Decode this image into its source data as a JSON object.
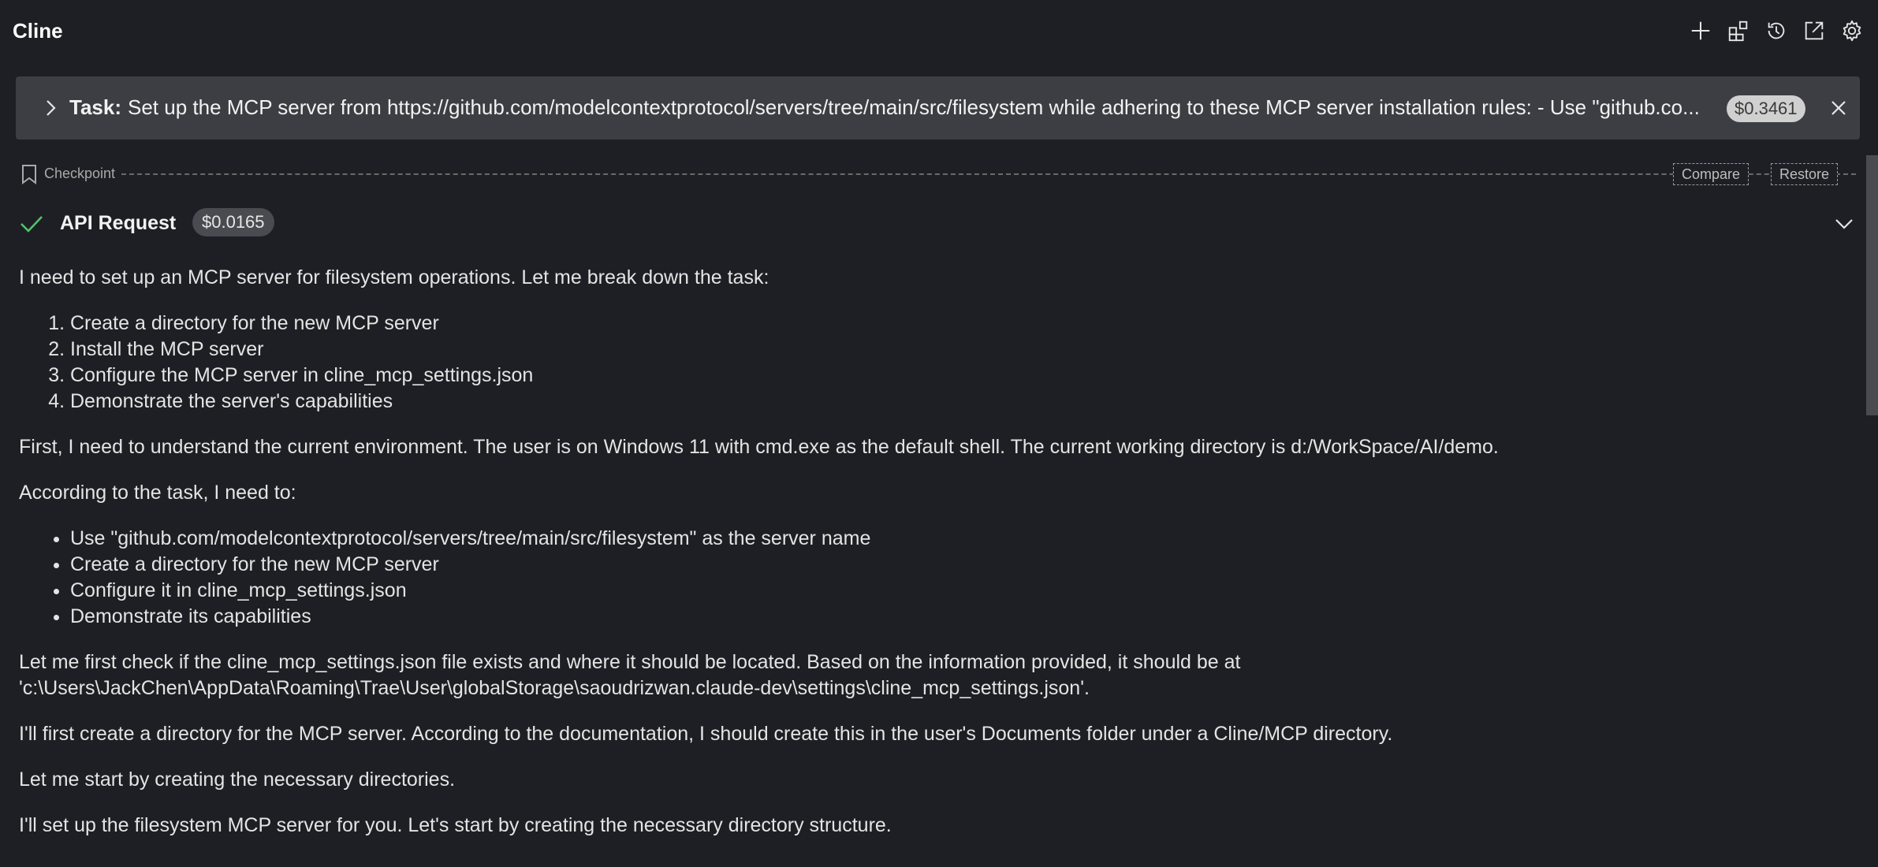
{
  "app": {
    "title": "Cline"
  },
  "header": {
    "actions": [
      {
        "name": "new-task",
        "icon": "plus-icon"
      },
      {
        "name": "mcp-servers",
        "icon": "extensions-icon"
      },
      {
        "name": "history",
        "icon": "history-icon"
      },
      {
        "name": "open-in-editor",
        "icon": "external-link-icon"
      },
      {
        "name": "settings",
        "icon": "gear-icon"
      }
    ]
  },
  "task": {
    "label": "Task:",
    "text": "Set up the MCP server from https://github.com/modelcontextprotocol/servers/tree/main/src/filesystem while adhering to these MCP server installation rules: - Use \"github.co...",
    "cost": "$0.3461"
  },
  "checkpoint": {
    "label": "Checkpoint",
    "compare_label": "Compare",
    "restore_label": "Restore"
  },
  "api_request": {
    "title": "API Request",
    "cost": "$0.0165",
    "status_color": "#4ec46a"
  },
  "message": {
    "intro": "I need to set up an MCP server for filesystem operations. Let me break down the task:",
    "steps": [
      "Create a directory for the new MCP server",
      "Install the MCP server",
      "Configure the MCP server in cline_mcp_settings.json",
      "Demonstrate the server's capabilities"
    ],
    "environment": "First, I need to understand the current environment. The user is on Windows 11 with cmd.exe as the default shell. The current working directory is d:/WorkSpace/AI/demo.",
    "according": "According to the task, I need to:",
    "requirements": [
      "Use \"github.com/modelcontextprotocol/servers/tree/main/src/filesystem\" as the server name",
      "Create a directory for the new MCP server",
      "Configure it in cline_mcp_settings.json",
      "Demonstrate its capabilities"
    ],
    "check_line1": "Let me first check if the cline_mcp_settings.json file exists and where it should be located. Based on the information provided, it should be at",
    "check_line2": "'c:\\Users\\JackChen\\AppData\\Roaming\\Trae\\User\\globalStorage\\saoudrizwan.claude-dev\\settings\\cline_mcp_settings.json'.",
    "create_dir": "I'll first create a directory for the MCP server. According to the documentation, I should create this in the user's Documents folder under a Cline/MCP directory.",
    "start": "Let me start by creating the necessary directories.",
    "setup": "I'll set up the filesystem MCP server for you. Let's start by creating the necessary directory structure."
  }
}
